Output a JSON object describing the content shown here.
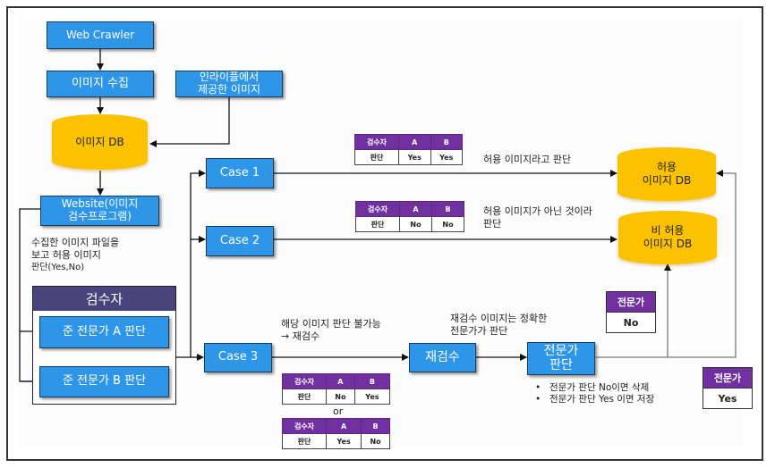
{
  "nodes": {
    "web_crawler": "Web  Crawler",
    "image_collect": "이미지 수집",
    "inlaiple_images": [
      "인라이플에서",
      "제공한 이미지"
    ],
    "image_db": "이미지 DB",
    "website": [
      "Website(이미지",
      "검수프로그램)"
    ],
    "case1": "Case 1",
    "case2": "Case 2",
    "case3": "Case 3",
    "recheck": "재검수",
    "expert_judge": [
      "전문가",
      "판단"
    ],
    "allowed_db": [
      "허용",
      "이미지 DB"
    ],
    "not_allowed_db": [
      "비 허용",
      "이미지 DB"
    ]
  },
  "reviewer_group": {
    "title": "검수자",
    "reviewer_a": "준 전문가 A 판단",
    "reviewer_b": "준 전문가 B 판단"
  },
  "annotations": {
    "website_desc": [
      "수집한 이미지 파일을",
      "보고 허용 이미지",
      "판단(Yes,No)"
    ],
    "case1_desc": "허용 이미지라고 판단",
    "case2_desc": [
      "허용 이미지가 아닌 것이라",
      "판단"
    ],
    "case3_desc": [
      "해당 이미지 판단 불가능",
      "→ 재검수"
    ],
    "recheck_desc": [
      "재검수 이미지는 정확한",
      "전문가가 판단"
    ],
    "or_label": "or",
    "expert_notes": [
      "전문가 판단 No이면 삭제",
      "전문가 판단 Yes 이면 저장"
    ]
  },
  "judgment_tables": {
    "headers": [
      "검수자",
      "A",
      "B"
    ],
    "row_label": "판단",
    "case1": [
      "Yes",
      "Yes"
    ],
    "case2": [
      "No",
      "No"
    ],
    "case3_option1": [
      "No",
      "Yes"
    ],
    "case3_option2": [
      "Yes",
      "No"
    ]
  },
  "expert_tables": {
    "header": "전문가",
    "no_value": "No",
    "yes_value": "Yes"
  },
  "colors": {
    "process_box": "#2e96e8",
    "database": "#fcc200",
    "group_header": "#4a447c",
    "table_header": "#7030a0"
  }
}
